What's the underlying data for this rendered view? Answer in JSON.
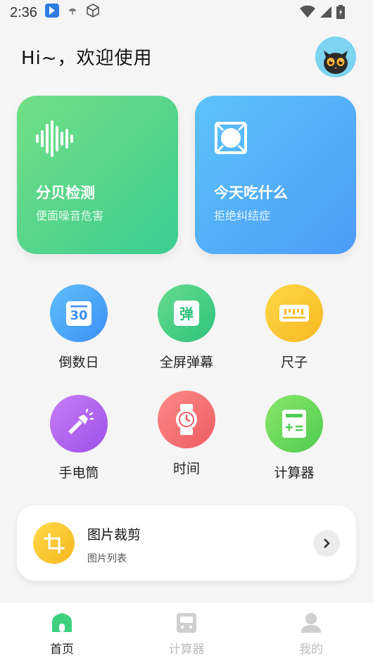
{
  "status_bar": {
    "time": "2:36"
  },
  "header": {
    "greeting": "Hi~，欢迎使用"
  },
  "feature_cards": [
    {
      "title": "分贝检测",
      "subtitle": "便面噪音危害",
      "icon": "sound-wave-icon",
      "color": "#3ccc92"
    },
    {
      "title": "今天吃什么",
      "subtitle": "拒绝纠结症",
      "icon": "food-frame-icon",
      "color": "#4c9cf7"
    }
  ],
  "tools": [
    {
      "label": "倒数日",
      "icon": "calendar-30-icon",
      "color": "#4aa5f8"
    },
    {
      "label": "全屏弹幕",
      "icon": "danmaku-icon",
      "color": "#3dc983"
    },
    {
      "label": "尺子",
      "icon": "ruler-icon",
      "color": "#f6c02a"
    },
    {
      "label": "手电筒",
      "icon": "flashlight-icon",
      "color": "#a95bec"
    },
    {
      "label": "时间",
      "icon": "watch-icon",
      "color": "#f06b6f"
    },
    {
      "label": "计算器",
      "icon": "calculator-icon",
      "color": "#5bd158"
    }
  ],
  "list_item": {
    "title": "图片裁剪",
    "subtitle": "图片列表",
    "icon": "crop-icon"
  },
  "bottom_nav": [
    {
      "label": "首页",
      "icon": "home-icon",
      "active": true
    },
    {
      "label": "计算器",
      "icon": "bus-icon",
      "active": false
    },
    {
      "label": "我的",
      "icon": "user-icon",
      "active": false
    }
  ],
  "colors": {
    "accent_green": "#3dd17f",
    "background": "#f5f5f5"
  }
}
